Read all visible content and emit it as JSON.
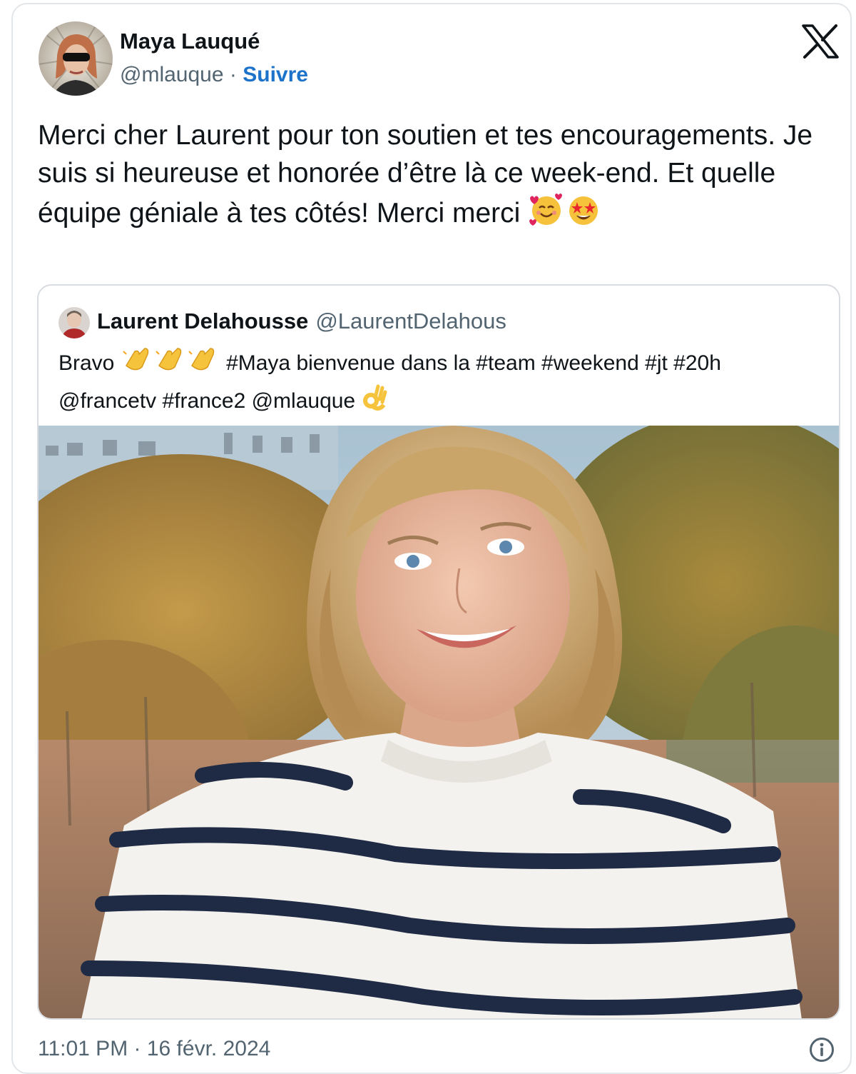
{
  "author": {
    "name": "Maya Lauqué",
    "handle": "@mlauque",
    "separator": "·",
    "follow_label": "Suivre"
  },
  "brand_icon": "x-logo",
  "tweet": {
    "text": "Merci cher Laurent pour ton soutien et tes encouragements. Je suis si heureuse et honorée d’être là ce week-end. Et quelle équipe géniale à tes côtés! Merci merci",
    "emojis": [
      "smiling-face-with-hearts",
      "star-struck"
    ]
  },
  "quoted": {
    "name": "Laurent Delahousse",
    "handle": "@LaurentDelahous",
    "text_start": "Bravo",
    "text_rest": "#Maya bienvenue dans la #team #weekend #jt #20h @francetv #france2 @mlauque",
    "emojis": [
      "clapping-hands",
      "clapping-hands",
      "clapping-hands",
      "ok-hand"
    ]
  },
  "footer": {
    "timestamp": "11:01 PM · 16 févr. 2024",
    "info_icon": "info-icon"
  },
  "colors": {
    "text": "#0f1419",
    "secondary": "#536471",
    "link": "#1d72c9",
    "border": "#d9dde1"
  }
}
